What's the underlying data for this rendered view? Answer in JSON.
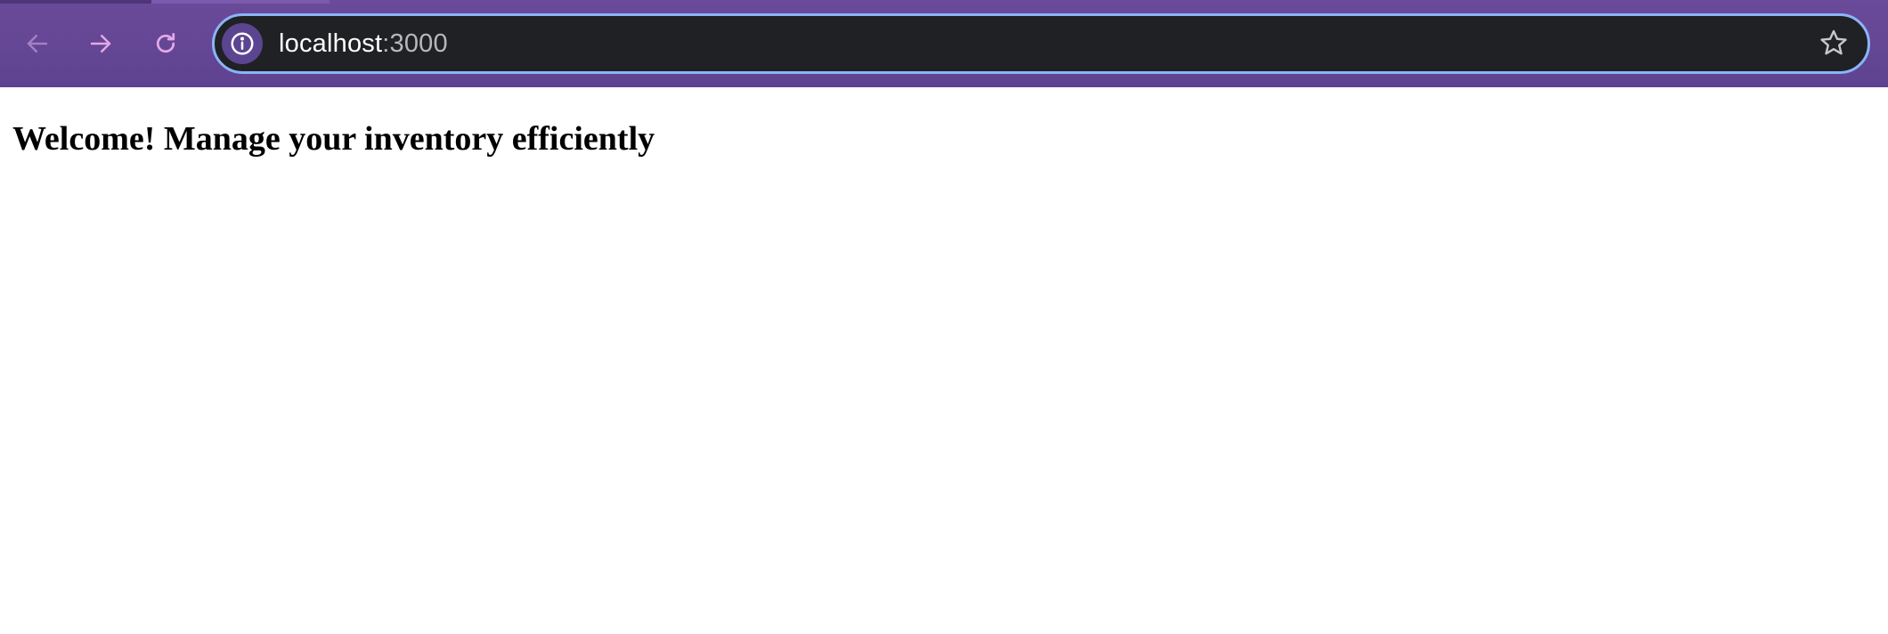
{
  "browser": {
    "omnibox": {
      "url_host": "localhost",
      "url_port": ":3000"
    },
    "icons": {
      "back": "arrow-left-icon",
      "forward": "arrow-right-icon",
      "reload": "reload-icon",
      "site_info": "info-icon",
      "bookmark": "star-icon"
    },
    "colors": {
      "toolbar": "#5e4390",
      "omnibox_bg": "#202124",
      "omnibox_border": "#8ab4f8",
      "nav_icon": "#e3a8e8"
    }
  },
  "page": {
    "heading": "Welcome! Manage your inventory efficiently"
  }
}
